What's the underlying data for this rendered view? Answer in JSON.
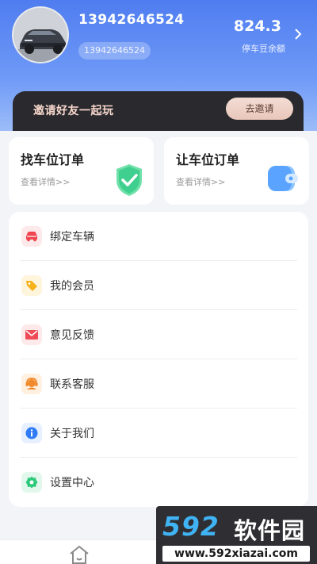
{
  "profile": {
    "phone": "13942646524",
    "phone_pill": "13942646524",
    "balance_value": "824.3",
    "balance_label": "停车豆余额"
  },
  "invite": {
    "text": "邀请好友一起玩",
    "button": "去邀请"
  },
  "orders": [
    {
      "title": "找车位订单",
      "sub": "查看详情>>",
      "icon": "shield-check-icon",
      "color": "#3fcf8e"
    },
    {
      "title": "让车位订单",
      "sub": "查看详情>>",
      "icon": "wallet-icon",
      "color": "#5aa3ff"
    }
  ],
  "menu": [
    {
      "label": "绑定车辆",
      "icon": "car-icon",
      "color": "#f0444f",
      "bg": "#fde9ea"
    },
    {
      "label": "我的会员",
      "icon": "tag-icon",
      "color": "#f7b21b",
      "bg": "#fff5dc"
    },
    {
      "label": "意见反馈",
      "icon": "mail-icon",
      "color": "#ef4b57",
      "bg": "#fde9ea"
    },
    {
      "label": "联系客服",
      "icon": "support-agent-icon",
      "color": "#f08a2b",
      "bg": "#fff0e0"
    },
    {
      "label": "关于我们",
      "icon": "info-icon",
      "color": "#2f7cf6",
      "bg": "#e6f0ff"
    },
    {
      "label": "设置中心",
      "icon": "gear-icon",
      "color": "#2dc97a",
      "bg": "#e2f8ec"
    }
  ],
  "bottom_nav": {
    "home_icon": "home-icon"
  },
  "watermark": {
    "logo_digits": "592",
    "logo_cn": "软件园",
    "url": "www.592xiazai.com"
  }
}
